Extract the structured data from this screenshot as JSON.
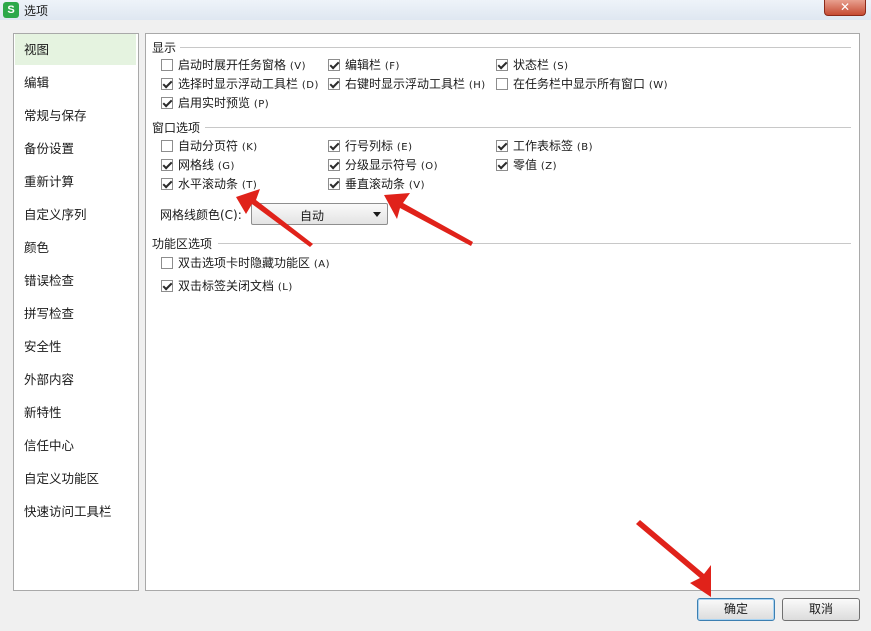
{
  "window": {
    "title": "选项",
    "app_icon": "S",
    "close_glyph": "✕"
  },
  "sidebar": {
    "items": [
      {
        "label": "视图",
        "selected": true
      },
      {
        "label": "编辑"
      },
      {
        "label": "常规与保存"
      },
      {
        "label": "备份设置"
      },
      {
        "label": "重新计算"
      },
      {
        "label": "自定义序列"
      },
      {
        "label": "颜色"
      },
      {
        "label": "错误检查"
      },
      {
        "label": "拼写检查"
      },
      {
        "label": "安全性"
      },
      {
        "label": "外部内容"
      },
      {
        "label": "新特性"
      },
      {
        "label": "信任中心"
      },
      {
        "label": "自定义功能区"
      },
      {
        "label": "快速访问工具栏"
      }
    ]
  },
  "display": {
    "title": "显示",
    "options": [
      {
        "label": "启动时展开任务窗格",
        "key": "(V)",
        "checked": false
      },
      {
        "label": "编辑栏",
        "key": "(F)",
        "checked": true
      },
      {
        "label": "状态栏",
        "key": "(S)",
        "checked": true
      },
      {
        "label": "选择时显示浮动工具栏",
        "key": "(D)",
        "checked": true
      },
      {
        "label": "右键时显示浮动工具栏",
        "key": "(H)",
        "checked": true
      },
      {
        "label": "在任务栏中显示所有窗口",
        "key": "(W)",
        "checked": false
      },
      {
        "label": "启用实时预览",
        "key": "(P)",
        "checked": true
      }
    ]
  },
  "window_options": {
    "title": "窗口选项",
    "options": [
      {
        "label": "自动分页符",
        "key": "(K)",
        "checked": false
      },
      {
        "label": "行号列标",
        "key": "(E)",
        "checked": true
      },
      {
        "label": "工作表标签",
        "key": "(B)",
        "checked": true
      },
      {
        "label": "网格线",
        "key": "(G)",
        "checked": true
      },
      {
        "label": "分级显示符号",
        "key": "(O)",
        "checked": true
      },
      {
        "label": "零值",
        "key": "(Z)",
        "checked": true
      },
      {
        "label": "水平滚动条",
        "key": "(T)",
        "checked": true
      },
      {
        "label": "垂直滚动条",
        "key": "(V)",
        "checked": true
      }
    ],
    "gridline_color_label": "网格线颜色(C):",
    "gridline_color_value": "自动"
  },
  "ribbon": {
    "title": "功能区选项",
    "options": [
      {
        "label": "双击选项卡时隐藏功能区",
        "key": "(A)",
        "checked": false
      },
      {
        "label": "双击标签关闭文档",
        "key": "(L)",
        "checked": true
      }
    ]
  },
  "buttons": {
    "ok": "确定",
    "cancel": "取消"
  },
  "colors": {
    "annotation_arrow": "#e0221a",
    "selected_item_bg": "#e5f3e0",
    "app_icon_bg": "#2ca84a"
  }
}
